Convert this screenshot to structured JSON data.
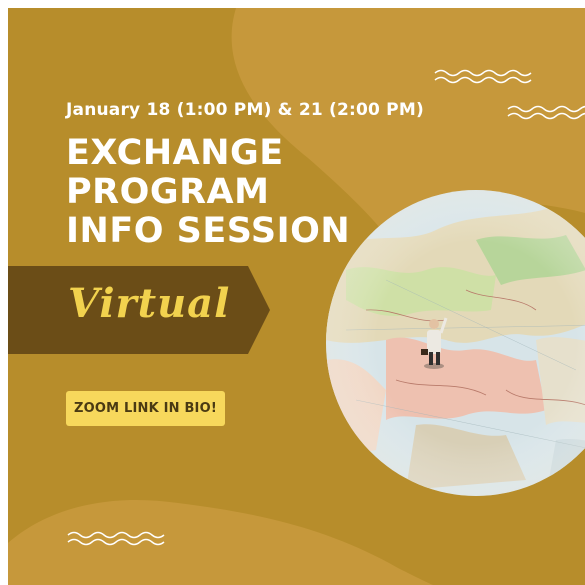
{
  "event": {
    "date_line": "January 18 (1:00 PM) & 21 (2:00 PM)",
    "title_lines": [
      "EXCHANGE",
      "PROGRAM",
      "INFO SESSION"
    ],
    "format_label": "Virtual",
    "link_button": "ZOOM LINK IN BIO!"
  },
  "colors": {
    "background": "#b78d2b",
    "light_blob": "#c6983b",
    "banner": "#6b4d17",
    "accent_yellow": "#f7d85c",
    "text": "#ffffff"
  },
  "decorations": [
    "wave-icon",
    "wave-icon",
    "wave-icon",
    "map-photo"
  ]
}
